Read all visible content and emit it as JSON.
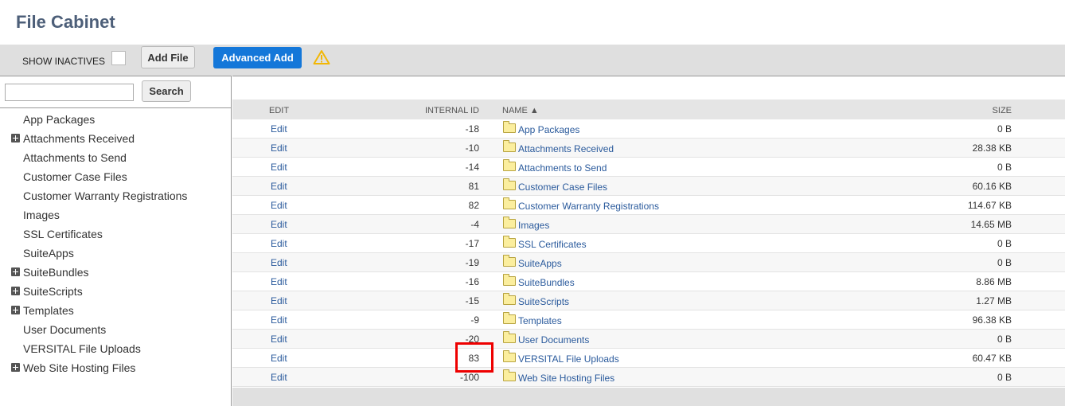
{
  "page": {
    "title": "File Cabinet"
  },
  "toolbar": {
    "show_inactives_label": "SHOW INACTIVES",
    "add_file_label": "Add File",
    "advanced_add_label": "Advanced Add",
    "warning_icon": "warning-triangle-icon",
    "accent_color": "#1477d9"
  },
  "search": {
    "value": "",
    "button_label": "Search"
  },
  "tree": {
    "items": [
      {
        "label": "App Packages",
        "expandable": false
      },
      {
        "label": "Attachments Received",
        "expandable": true
      },
      {
        "label": "Attachments to Send",
        "expandable": false
      },
      {
        "label": "Customer Case Files",
        "expandable": false
      },
      {
        "label": "Customer Warranty Registrations",
        "expandable": false
      },
      {
        "label": "Images",
        "expandable": false
      },
      {
        "label": "SSL Certificates",
        "expandable": false
      },
      {
        "label": "SuiteApps",
        "expandable": false
      },
      {
        "label": "SuiteBundles",
        "expandable": true
      },
      {
        "label": "SuiteScripts",
        "expandable": true
      },
      {
        "label": "Templates",
        "expandable": true
      },
      {
        "label": "User Documents",
        "expandable": false
      },
      {
        "label": "VERSITAL File Uploads",
        "expandable": false
      },
      {
        "label": "Web Site Hosting Files",
        "expandable": true
      }
    ]
  },
  "table": {
    "columns": {
      "edit": "EDIT",
      "internal_id": "INTERNAL ID",
      "name": "NAME ▲",
      "size": "SIZE"
    },
    "rows": [
      {
        "edit": "Edit",
        "id": "-18",
        "name": "App Packages",
        "size": "0 B"
      },
      {
        "edit": "Edit",
        "id": "-10",
        "name": "Attachments Received",
        "size": "28.38 KB"
      },
      {
        "edit": "Edit",
        "id": "-14",
        "name": "Attachments to Send",
        "size": "0 B"
      },
      {
        "edit": "Edit",
        "id": "81",
        "name": "Customer Case Files",
        "size": "60.16 KB"
      },
      {
        "edit": "Edit",
        "id": "82",
        "name": "Customer Warranty Registrations",
        "size": "114.67 KB"
      },
      {
        "edit": "Edit",
        "id": "-4",
        "name": "Images",
        "size": "14.65 MB"
      },
      {
        "edit": "Edit",
        "id": "-17",
        "name": "SSL Certificates",
        "size": "0 B"
      },
      {
        "edit": "Edit",
        "id": "-19",
        "name": "SuiteApps",
        "size": "0 B"
      },
      {
        "edit": "Edit",
        "id": "-16",
        "name": "SuiteBundles",
        "size": "8.86 MB"
      },
      {
        "edit": "Edit",
        "id": "-15",
        "name": "SuiteScripts",
        "size": "1.27 MB"
      },
      {
        "edit": "Edit",
        "id": "-9",
        "name": "Templates",
        "size": "96.38 KB"
      },
      {
        "edit": "Edit",
        "id": "-20",
        "name": "User Documents",
        "size": "0 B"
      },
      {
        "edit": "Edit",
        "id": "83",
        "name": "VERSITAL File Uploads",
        "size": "60.47 KB"
      },
      {
        "edit": "Edit",
        "id": "-100",
        "name": "Web Site Hosting Files",
        "size": "0 B"
      }
    ]
  },
  "annotation": {
    "highlight_color": "#e00000",
    "highlighted_value": "83"
  }
}
